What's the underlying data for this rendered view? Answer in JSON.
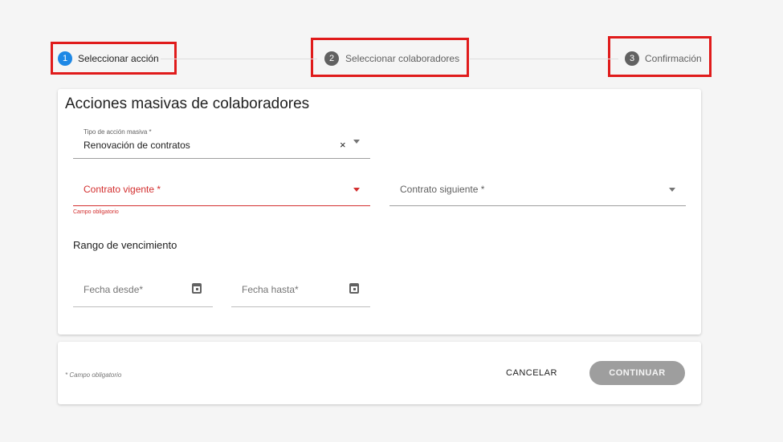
{
  "stepper": {
    "steps": [
      {
        "number": "1",
        "label": "Seleccionar acción",
        "active": true
      },
      {
        "number": "2",
        "label": "Seleccionar colaboradores",
        "active": false
      },
      {
        "number": "3",
        "label": "Confirmación",
        "active": false
      }
    ]
  },
  "colors": {
    "active": "#1e88e5",
    "inactive": "#616161",
    "error": "#d32f2f",
    "highlight": "#e01b1b"
  },
  "form": {
    "title": "Acciones masivas de colaboradores",
    "tipo_label": "Tipo de acción masiva *",
    "tipo_value": "Renovación de contratos",
    "contrato_vigente_label": "Contrato vigente *",
    "contrato_vigente_error": "Campo obligatorio",
    "contrato_siguiente_label": "Contrato siguiente *",
    "rango_title": "Rango de vencimiento",
    "fecha_desde": "Fecha desde*",
    "fecha_hasta": "Fecha hasta*"
  },
  "footer": {
    "note": "* Campo obligatorio",
    "cancel": "CANCELAR",
    "continue": "CONTINUAR"
  }
}
